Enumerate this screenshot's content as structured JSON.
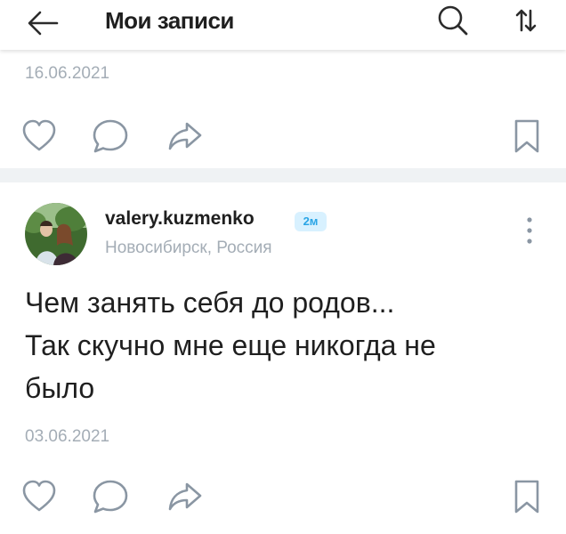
{
  "header": {
    "title": "Мои записи",
    "back_icon": "arrow-left-icon",
    "search_icon": "search-icon",
    "sort_icon": "sort-arrows-icon"
  },
  "posts": [
    {
      "date": "16.06.2021",
      "actions": [
        "heart-icon",
        "comment-icon",
        "share-icon",
        "bookmark-icon"
      ]
    },
    {
      "author": "valery.kuzmenko",
      "age_badge": "2м",
      "location": "Новосибирск, Россия",
      "text_lines": [
        "Чем занять себя до родов...",
        "Так скучно мне еще никогда не",
        "было"
      ],
      "date": "03.06.2021",
      "actions": [
        "heart-icon",
        "comment-icon",
        "share-icon",
        "bookmark-icon"
      ]
    }
  ],
  "colors": {
    "text": "#1f1f1f",
    "muted": "#a4adb6",
    "icon": "#8a96a3",
    "badge_bg": "#d8f1ff",
    "badge_text": "#2aa5e6",
    "divider": "#eff2f4"
  }
}
